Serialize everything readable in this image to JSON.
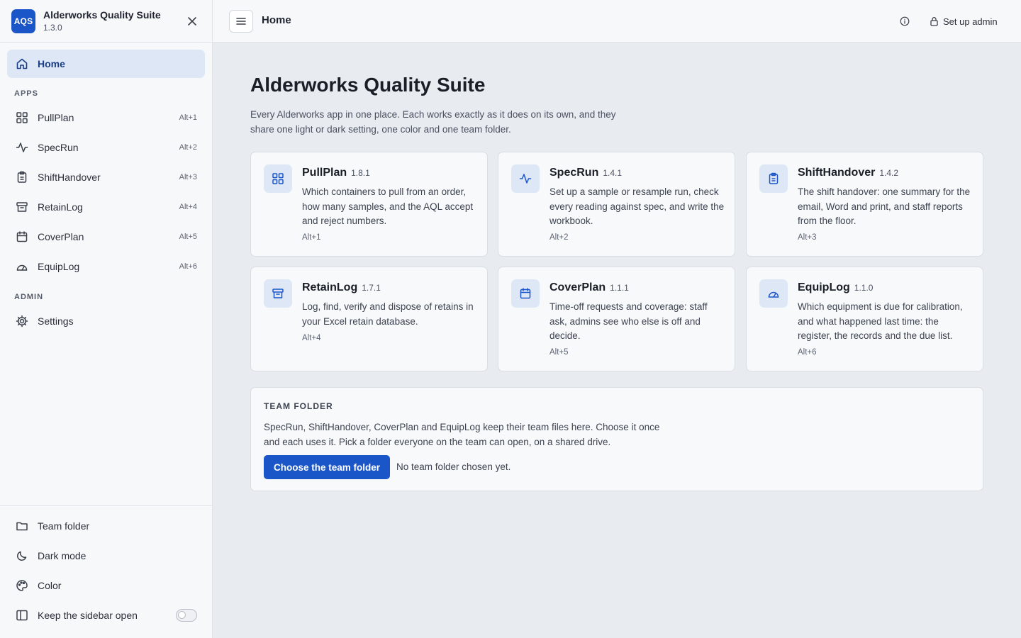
{
  "app": {
    "logo_text": "AQS",
    "name": "Alderworks Quality Suite",
    "version": "1.3.0"
  },
  "sidebar": {
    "home_label": "Home",
    "apps_heading": "APPS",
    "admin_heading": "ADMIN",
    "apps": [
      {
        "label": "PullPlan",
        "shortcut": "Alt+1",
        "icon": "grid-icon"
      },
      {
        "label": "SpecRun",
        "shortcut": "Alt+2",
        "icon": "activity-icon"
      },
      {
        "label": "ShiftHandover",
        "shortcut": "Alt+3",
        "icon": "clipboard-icon"
      },
      {
        "label": "RetainLog",
        "shortcut": "Alt+4",
        "icon": "archive-icon"
      },
      {
        "label": "CoverPlan",
        "shortcut": "Alt+5",
        "icon": "calendar-icon"
      },
      {
        "label": "EquipLog",
        "shortcut": "Alt+6",
        "icon": "gauge-icon"
      }
    ],
    "settings_label": "Settings",
    "bottom": {
      "team_folder_label": "Team folder",
      "dark_mode_label": "Dark mode",
      "color_label": "Color",
      "keep_open_label": "Keep the sidebar open",
      "keep_open_value": false
    }
  },
  "header": {
    "title": "Home",
    "admin_label": "Set up admin"
  },
  "main": {
    "title": "Alderworks Quality Suite",
    "description": "Every Alderworks app in one place. Each works exactly as it does on its own, and they share one light or dark setting, one color and one team folder.",
    "cards": [
      {
        "name": "PullPlan",
        "version": "1.8.1",
        "description": "Which containers to pull from an order, how many samples, and the AQL accept and reject numbers.",
        "shortcut": "Alt+1",
        "icon": "grid-icon"
      },
      {
        "name": "SpecRun",
        "version": "1.4.1",
        "description": "Set up a sample or resample run, check every reading against spec, and write the workbook.",
        "shortcut": "Alt+2",
        "icon": "activity-icon"
      },
      {
        "name": "ShiftHandover",
        "version": "1.4.2",
        "description": "The shift handover: one summary for the email, Word and print, and staff reports from the floor.",
        "shortcut": "Alt+3",
        "icon": "clipboard-icon"
      },
      {
        "name": "RetainLog",
        "version": "1.7.1",
        "description": "Log, find, verify and dispose of retains in your Excel retain database.",
        "shortcut": "Alt+4",
        "icon": "archive-icon"
      },
      {
        "name": "CoverPlan",
        "version": "1.1.1",
        "description": "Time-off requests and coverage: staff ask, admins see who else is off and decide.",
        "shortcut": "Alt+5",
        "icon": "calendar-icon"
      },
      {
        "name": "EquipLog",
        "version": "1.1.0",
        "description": "Which equipment is due for calibration, and what happened last time: the register, the records and the due list.",
        "shortcut": "Alt+6",
        "icon": "gauge-icon"
      }
    ],
    "team_folder": {
      "heading": "TEAM FOLDER",
      "description": "SpecRun, ShiftHandover, CoverPlan and EquipLog keep their team files here. Choose it once and each uses it. Pick a folder everyone on the team can open, on a shared drive.",
      "button_label": "Choose the team folder",
      "status": "No team folder chosen yet."
    }
  },
  "colors": {
    "accent": "#1a56c8",
    "accent_soft": "#dde7f6",
    "background": "#e8ebf0",
    "surface": "#f7f8fa"
  }
}
